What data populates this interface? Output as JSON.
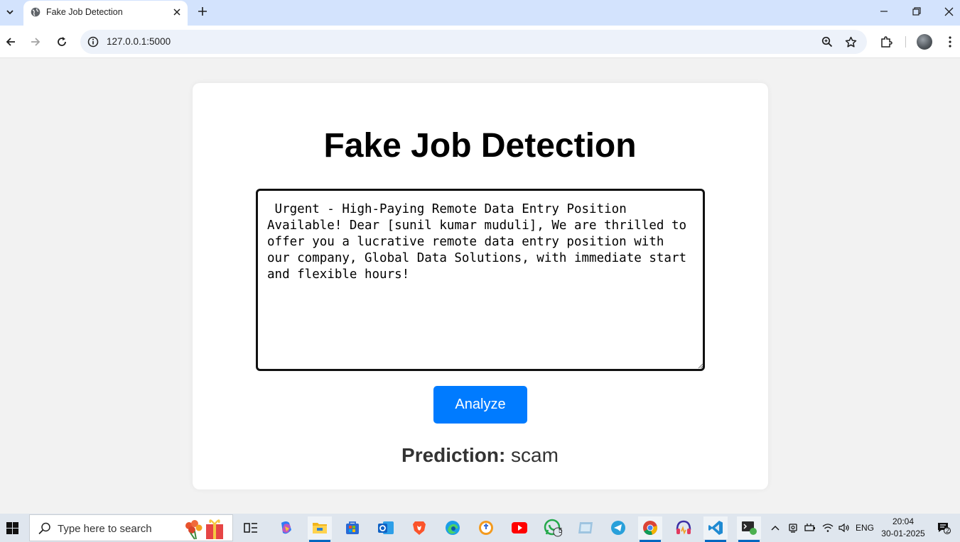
{
  "browser": {
    "tab_title": "Fake Job Detection",
    "url": "127.0.0.1:5000"
  },
  "page": {
    "title": "Fake Job Detection",
    "job_text": " Urgent - High-Paying Remote Data Entry Position Available! Dear [sunil kumar muduli], We are thrilled to offer you a lucrative remote data entry position with our company, Global Data Solutions, with immediate start and flexible hours!",
    "analyze_label": "Analyze",
    "prediction_label": "Prediction:",
    "prediction_value": "scam"
  },
  "taskbar": {
    "search_placeholder": "Type here to search",
    "whatsapp_badge": "5",
    "language": "ENG",
    "time": "20:04",
    "date": "30-01-2025",
    "notification_count": "2"
  },
  "colors": {
    "accent_button": "#007bff",
    "tab_strip": "#d3e3fd",
    "page_background": "#f2f2f2"
  }
}
